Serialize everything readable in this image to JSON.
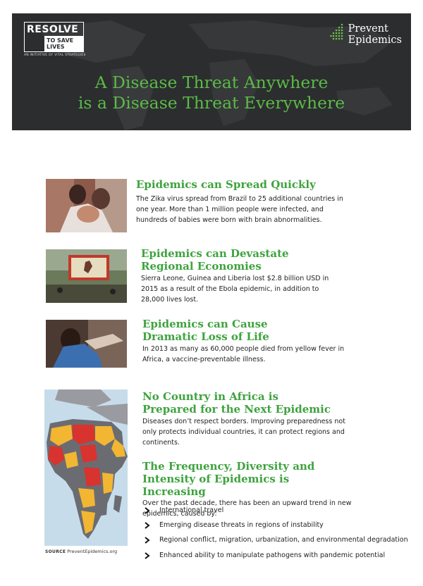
{
  "header": {
    "resolve_word": "RESOLVE",
    "resolve_tagline": "TO SAVE LIVES",
    "resolve_initiative": "AN INITIATIVE OF VITAL STRATEGIES",
    "prevent_logo_line1": "Prevent",
    "prevent_logo_line2": "Epidemics",
    "title_line1": "A Disease Threat Anywhere",
    "title_line2": "is a Disease Threat Everywhere"
  },
  "sections": [
    {
      "heading": "Epidemics can Spread Quickly",
      "body": "The Zika virus spread from Brazil to 25 additional countries in one year. More than 1 million people were infected, and hundreds of babies were born with brain abnormalities."
    },
    {
      "heading_line1": "Epidemics can Devastate",
      "heading_line2": "Regional Economies",
      "body": "Sierra Leone, Guinea and Liberia lost $2.8 billion USD in 2015 as a result of the Ebola epidemic, in addition to 28,000 lives lost."
    },
    {
      "heading_line1": "Epidemics can Cause",
      "heading_line2": "Dramatic Loss of Life",
      "body": "In 2013 as many as 60,000 people died from yellow fever in Africa, a vaccine-preventable illness."
    },
    {
      "heading_line1": "No Country in Africa is",
      "heading_line2": "Prepared for the Next Epidemic",
      "body": "Diseases don’t respect borders. Improving preparedness not only protects individual countries, it can protect regions and continents."
    },
    {
      "heading_line1": "The Frequency, Diversity and",
      "heading_line2": "Intensity of Epidemics is Increasing",
      "body": "Over the past decade, there has been an upward trend in new epidemics, caused by:"
    }
  ],
  "bullets": [
    "International travel",
    "Emerging disease threats in regions of instability",
    "Regional conflict, migration, urbanization, and environmental degradation",
    "Enhanced ability to manipulate pathogens with pandemic potential"
  ],
  "source": {
    "label": "SOURCE",
    "value": "PreventEpidemics.org"
  },
  "colors": {
    "green": "#3ea33e",
    "header_bg": "#2d2f31",
    "map_red": "#d8332e",
    "map_yellow": "#f2b632"
  }
}
